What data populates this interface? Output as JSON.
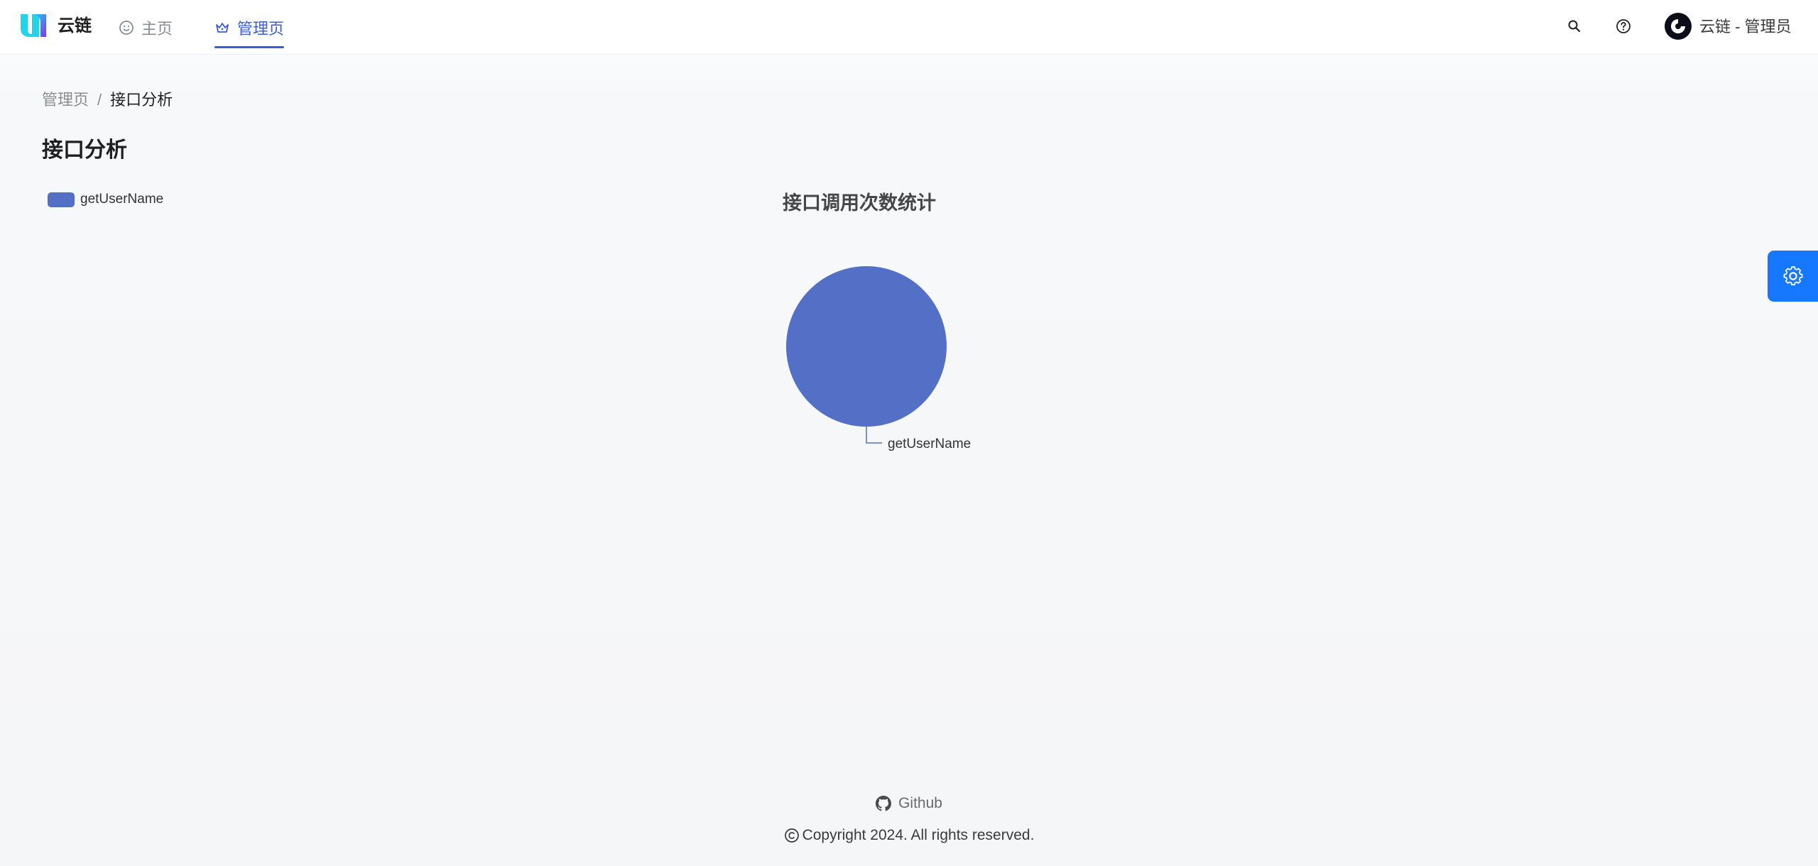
{
  "app": {
    "title": "云链",
    "brand_colors": [
      "#22d3ee",
      "#7c3aed"
    ]
  },
  "nav": {
    "items": [
      {
        "label": "主页",
        "icon": "smile-icon",
        "active": false
      },
      {
        "label": "管理页",
        "icon": "crown-icon",
        "active": true
      }
    ],
    "active_color": "#3b5bdb"
  },
  "header": {
    "search_icon": "search-icon",
    "help_icon": "question-circle-icon",
    "user_label": "云链 - 管理员"
  },
  "breadcrumb": {
    "parent": "管理页",
    "separator": "/",
    "current": "接口分析"
  },
  "page": {
    "title": "接口分析"
  },
  "settings": {
    "icon": "gear-icon",
    "color": "#1677ff"
  },
  "chart_data": {
    "type": "pie",
    "title": "接口调用次数统计",
    "legend_position": "top-left",
    "series": [
      {
        "name": "getUserName",
        "value": 1,
        "color": "#5470c6"
      }
    ]
  },
  "footer": {
    "github_label": "Github",
    "copyright": "Copyright 2024. All rights reserved."
  }
}
